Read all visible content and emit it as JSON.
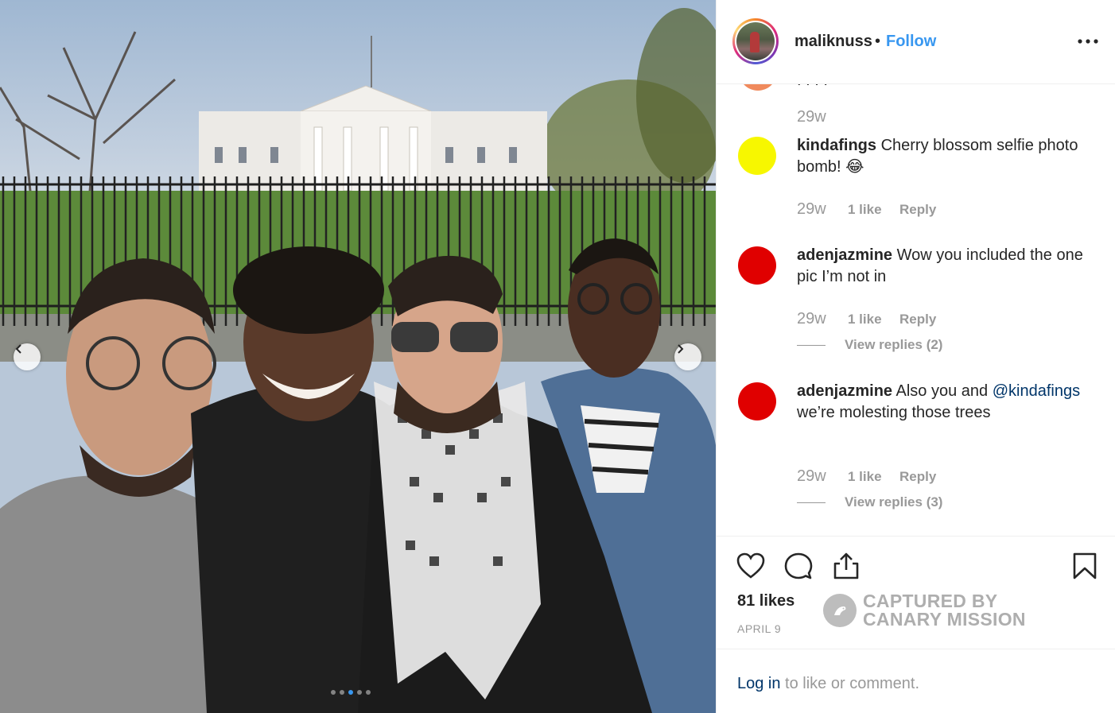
{
  "post": {
    "username": "maliknuss",
    "separator": "•",
    "follow_label": "Follow",
    "likes": "81 likes",
    "date": "APRIL 9"
  },
  "icons": {
    "more": "more-horizontal-icon",
    "like": "heart-icon",
    "comment": "comment-bubble-icon",
    "share": "share-icon",
    "save": "bookmark-icon",
    "prev": "chevron-left-icon",
    "next": "chevron-right-icon"
  },
  "previous_comment": {
    "time": "29w"
  },
  "comments": [
    {
      "username": "kindafings",
      "text": " Cherry blossom selfie photo bomb! 😂",
      "time": "29w",
      "likes": "1 like",
      "reply": "Reply",
      "avatar_color": "#f7f700"
    },
    {
      "username": "adenjazmine",
      "text": " Wow you included the one pic I’m not in",
      "time": "29w",
      "likes": "1 like",
      "reply": "Reply",
      "view_replies": "View replies (2)",
      "avatar_color": "#e00000"
    },
    {
      "username": "adenjazmine",
      "text_before": " Also you and ",
      "mention": "@kindafings",
      "text_after": " we’re molesting those trees",
      "time": "29w",
      "likes": "1 like",
      "reply": "Reply",
      "view_replies": "View replies (3)",
      "avatar_color": "#e00000"
    }
  ],
  "watermark": {
    "line1": "CAPTURED BY",
    "line2": "CANARY MISSION"
  },
  "login": {
    "link": "Log in",
    "rest": " to like or comment."
  },
  "carousel": {
    "total": 5,
    "active_index": 2
  },
  "colors": {
    "link_blue": "#3897f0",
    "dark_link": "#003569",
    "muted": "#999999"
  }
}
